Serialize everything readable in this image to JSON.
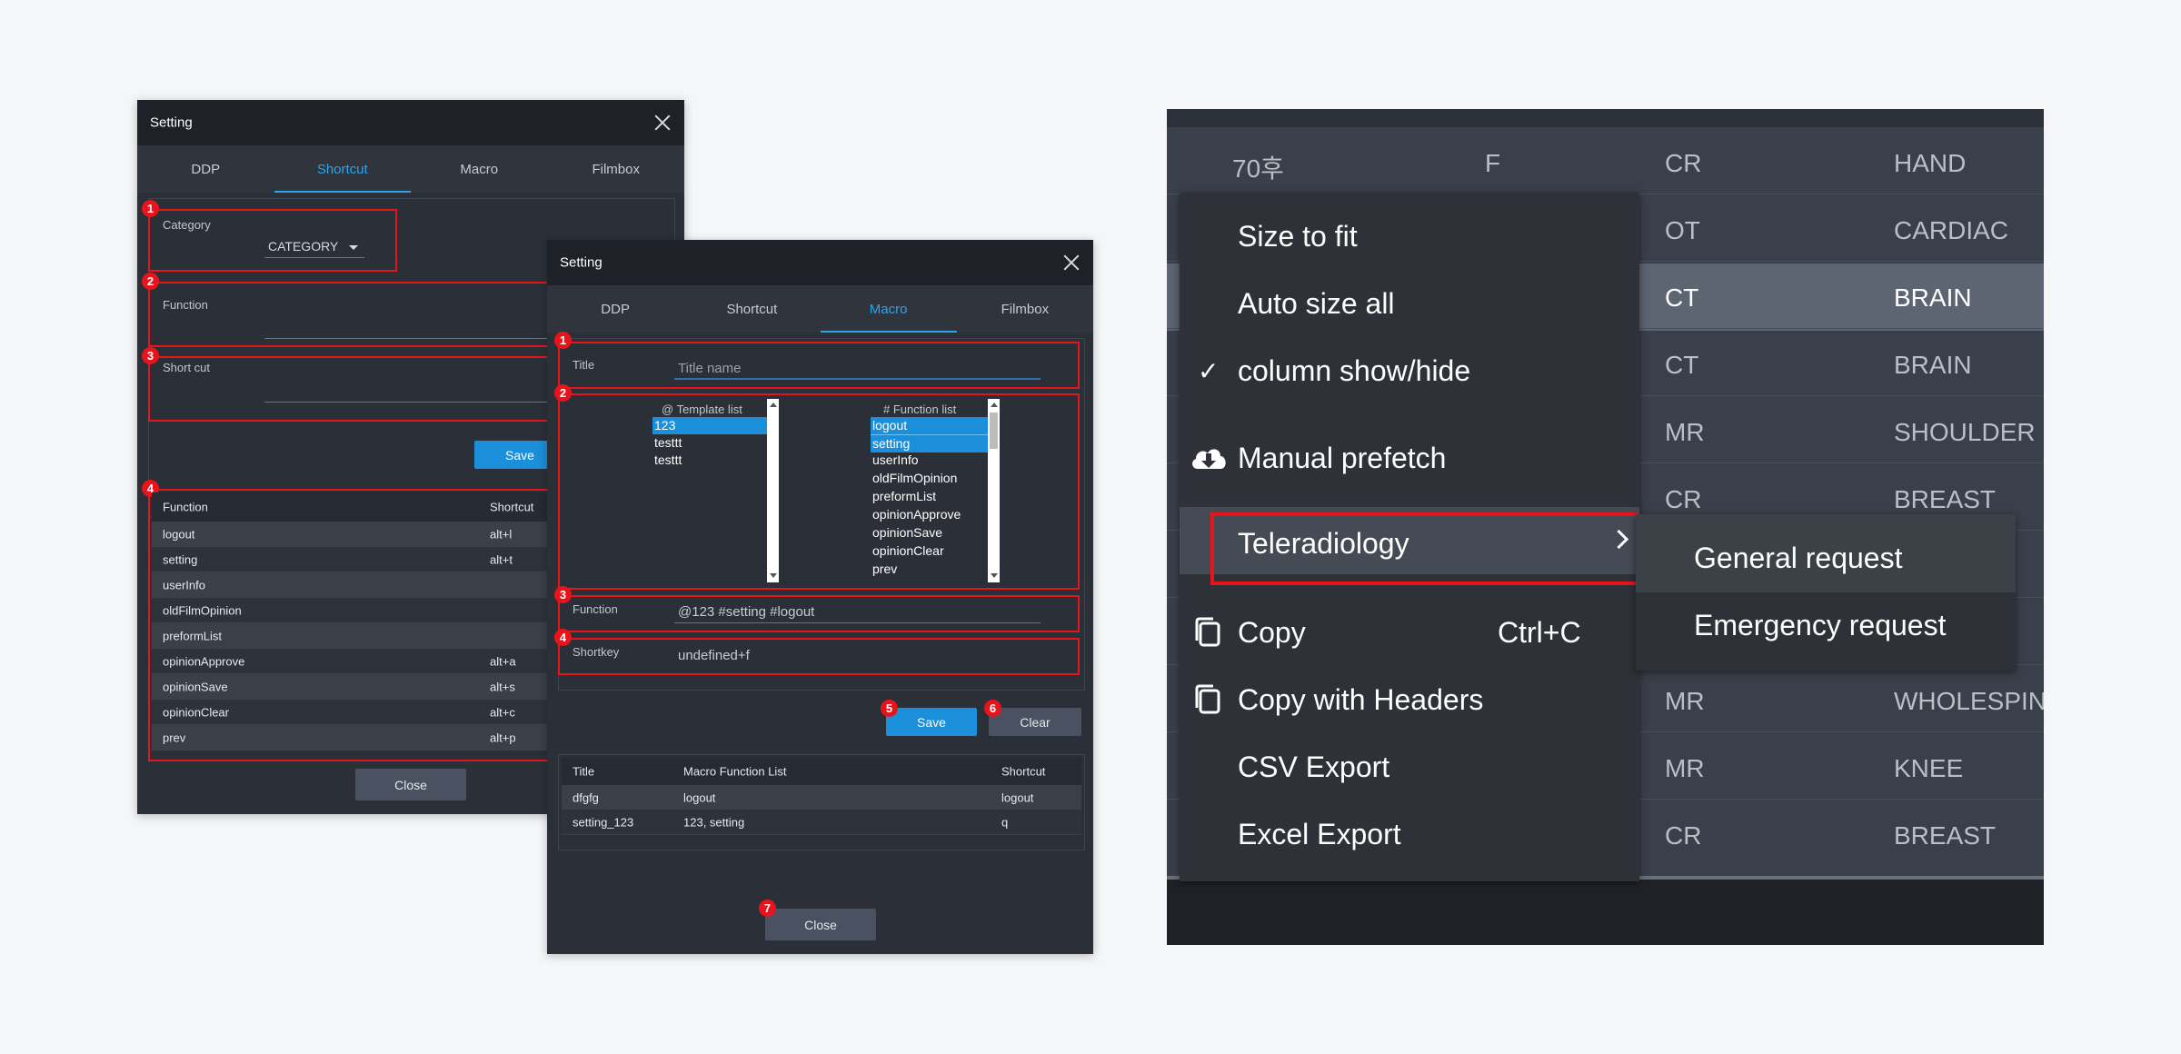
{
  "shortcut_dialog": {
    "title": "Setting",
    "tabs": [
      "DDP",
      "Shortcut",
      "Macro",
      "Filmbox"
    ],
    "category_label": "Category",
    "category_value": "CATEGORY",
    "function_label": "Function",
    "shortcut_label": "Short cut",
    "save_label": "Save",
    "close_label": "Close",
    "badges": [
      "1",
      "2",
      "3",
      "4"
    ],
    "table_headers": [
      "Function",
      "Shortcut"
    ],
    "table_rows": [
      [
        "logout",
        "alt+l"
      ],
      [
        "setting",
        "alt+t"
      ],
      [
        "userInfo",
        ""
      ],
      [
        "oldFilmOpinion",
        ""
      ],
      [
        "preformList",
        ""
      ],
      [
        "opinionApprove",
        "alt+a"
      ],
      [
        "opinionSave",
        "alt+s"
      ],
      [
        "opinionClear",
        "alt+c"
      ],
      [
        "prev",
        "alt+p"
      ]
    ]
  },
  "macro_dialog": {
    "title": "Setting",
    "tabs": [
      "DDP",
      "Shortcut",
      "Macro",
      "Filmbox"
    ],
    "title_label": "Title",
    "title_placeholder": "Title name",
    "template_list_header": "@ Template list",
    "template_list": [
      "123",
      "testtt",
      "testtt"
    ],
    "function_list_header": "# Function list",
    "function_list": [
      "logout",
      "setting",
      "userInfo",
      "oldFilmOpinion",
      "preformList",
      "opinionApprove",
      "opinionSave",
      "opinionClear",
      "prev"
    ],
    "function_label": "Function",
    "function_value": "@123 #setting #logout",
    "shortkey_label": "Shortkey",
    "shortkey_value": "undefined+f",
    "save_label": "Save",
    "clear_label": "Clear",
    "close_label": "Close",
    "badges": [
      "1",
      "2",
      "3",
      "4",
      "5",
      "6",
      "7"
    ],
    "table_headers": [
      "Title",
      "Macro Function List",
      "Shortcut"
    ],
    "table_rows": [
      [
        "dfgfg",
        "logout",
        "logout"
      ],
      [
        "setting_123",
        "123, setting",
        "q"
      ]
    ]
  },
  "context_panel": {
    "grid_rows": [
      [
        "70후",
        "F",
        "CR",
        "HAND"
      ],
      [
        "",
        "",
        "OT",
        "CARDIAC"
      ],
      [
        "",
        "",
        "CT",
        "BRAIN"
      ],
      [
        "",
        "",
        "CT",
        "BRAIN"
      ],
      [
        "",
        "",
        "MR",
        "SHOULDER"
      ],
      [
        "",
        "",
        "CR",
        "BREAST"
      ],
      [
        "",
        "",
        "",
        ""
      ],
      [
        "",
        "",
        "",
        ""
      ],
      [
        "",
        "",
        "MR",
        "WHOLESPIN"
      ],
      [
        "",
        "",
        "MR",
        "KNEE"
      ],
      [
        "",
        "",
        "CR",
        "BREAST"
      ]
    ],
    "menu": {
      "size_to_fit": "Size to fit",
      "auto_size_all": "Auto size all",
      "column_show_hide": "column show/hide",
      "check_glyph": "✓",
      "manual_prefetch": "Manual prefetch",
      "teleradiology": "Teleradiology",
      "copy": "Copy",
      "copy_shortcut": "Ctrl+C",
      "copy_with_headers": "Copy with Headers",
      "csv_export": "CSV Export",
      "excel_export": "Excel Export"
    },
    "submenu": {
      "general_request": "General request",
      "emergency_request": "Emergency request"
    },
    "icons": [
      "check-icon",
      "cloud-download-icon",
      "chevron-right-icon",
      "copy-icon"
    ],
    "colors": {
      "highlight": "#e8141c",
      "accent": "#1b8fd9",
      "menu_bg": "#2e3238"
    }
  }
}
